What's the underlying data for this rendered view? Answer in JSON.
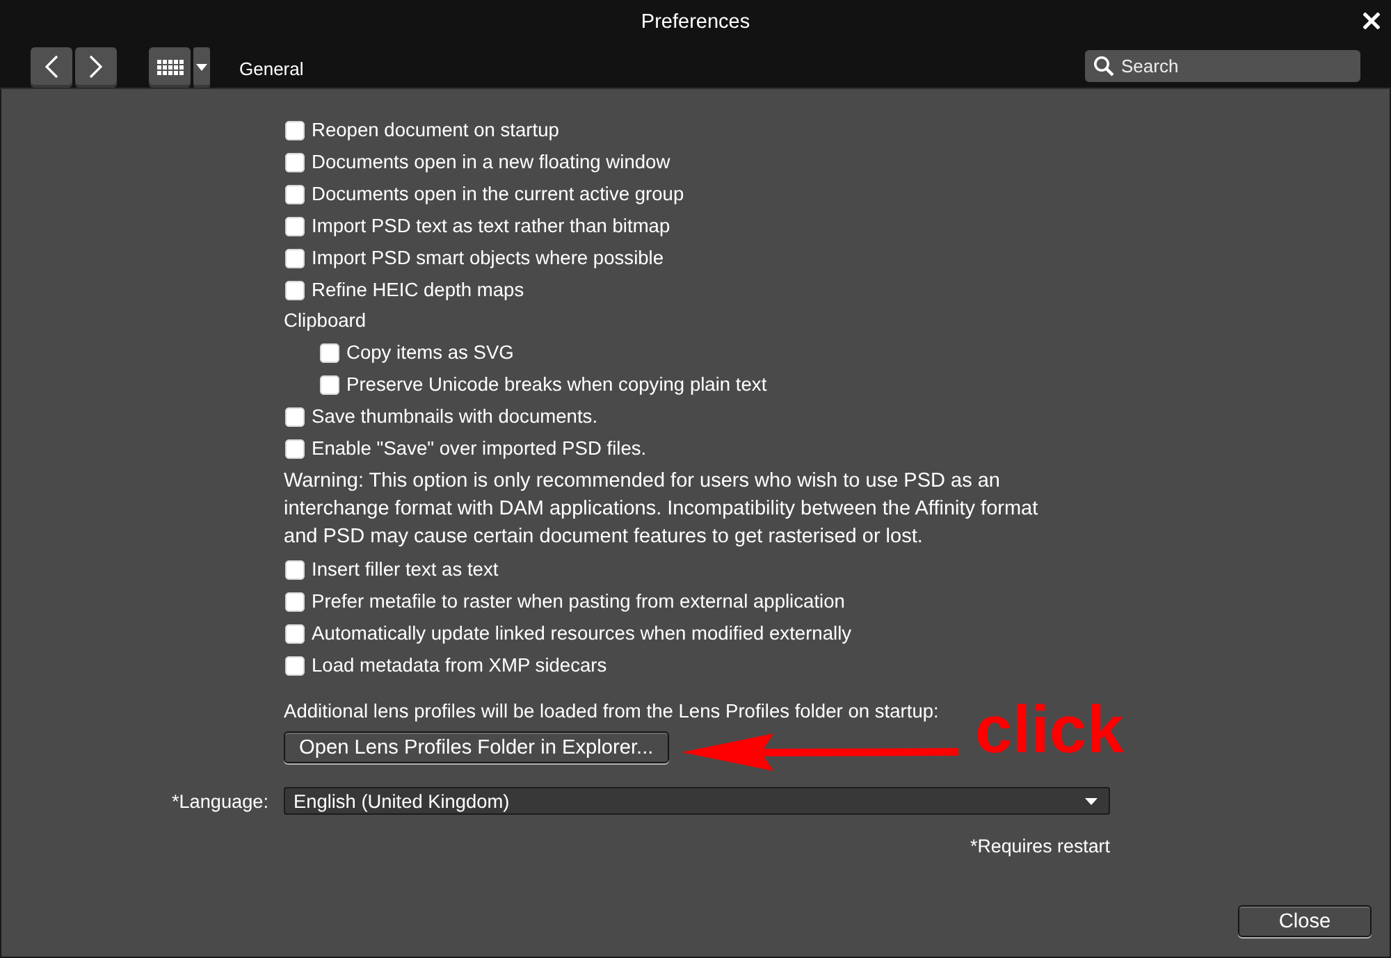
{
  "window": {
    "title": "Preferences"
  },
  "toolbar": {
    "section": "General",
    "search": {
      "placeholder": "Search"
    }
  },
  "options": [
    {
      "kind": "checkbox",
      "label": "Reopen document on startup",
      "checked": false
    },
    {
      "kind": "checkbox",
      "label": "Documents open in a new floating window",
      "checked": false
    },
    {
      "kind": "checkbox",
      "label": "Documents open in the current active group",
      "checked": false
    },
    {
      "kind": "checkbox",
      "label": "Import PSD text as text rather than bitmap",
      "checked": false
    },
    {
      "kind": "checkbox",
      "label": "Import PSD smart objects where possible",
      "checked": false
    },
    {
      "kind": "checkbox",
      "label": "Refine HEIC depth maps",
      "checked": false
    },
    {
      "kind": "group",
      "label": "Clipboard",
      "children": [
        {
          "kind": "checkbox",
          "label": "Copy items as SVG",
          "checked": false
        },
        {
          "kind": "checkbox",
          "label": "Preserve Unicode breaks when copying plain text",
          "checked": false
        }
      ]
    },
    {
      "kind": "checkbox",
      "label": "Save thumbnails with documents.",
      "checked": false
    },
    {
      "kind": "checkbox",
      "label": "Enable \"Save\" over imported PSD files.",
      "checked": false
    },
    {
      "kind": "note",
      "text": "Warning: This option is only recommended for users who wish to use PSD as an interchange format with DAM applications. Incompatibility between the Affinity format and PSD may cause certain document features to get rasterised or lost."
    },
    {
      "kind": "checkbox",
      "label": "Insert filler text as text",
      "checked": false
    },
    {
      "kind": "checkbox",
      "label": "Prefer metafile to raster when pasting from external application",
      "checked": false
    },
    {
      "kind": "checkbox",
      "label": "Automatically update linked resources when modified externally",
      "checked": false
    },
    {
      "kind": "checkbox",
      "label": "Load metadata from XMP sidecars",
      "checked": false
    }
  ],
  "lens_profiles": {
    "note": "Additional lens profiles will be loaded from the Lens Profiles folder on startup:",
    "button": "Open Lens Profiles Folder in Explorer..."
  },
  "language": {
    "label": "*Language:",
    "value": "English (United Kingdom)"
  },
  "restart_note": "*Requires restart",
  "annotation": {
    "text": "click"
  },
  "buttons": [
    "Close"
  ]
}
